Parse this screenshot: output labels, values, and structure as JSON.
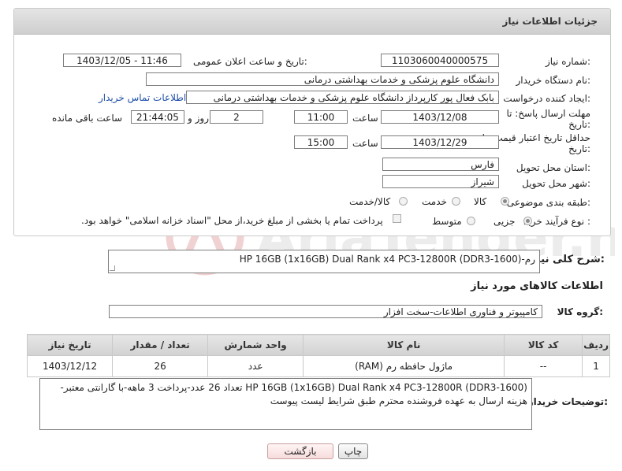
{
  "window_title": "جزئیات اطلاعات نیاز",
  "fields": {
    "need_number_label": "شماره نیاز:",
    "need_number": "1103060040000575",
    "announce_label": "تاریخ و ساعت اعلان عمومی:",
    "announce_value": "1403/12/05 - 11:46",
    "buyer_org_label": "نام دستگاه خریدار:",
    "buyer_org": "دانشگاه علوم پزشکی و خدمات بهداشتی درمانی",
    "requester_label": "ایجاد کننده درخواست:",
    "requester": "بابک فعال پور کارپرداز دانشگاه علوم پزشکی و خدمات بهداشتی درمانی",
    "contact_link": "اطلاعات تماس خریدار",
    "deadline_label_1": "مهلت ارسال پاسخ: تا",
    "deadline_label_2": "تاریخ:",
    "deadline_date": "1403/12/08",
    "time_label": "ساعت",
    "deadline_time": "11:00",
    "days_value": "2",
    "days_label": "روز و",
    "remaining_time": "21:44:05",
    "remaining_label": "ساعت باقی مانده",
    "validity_label_1": "حداقل تاریخ اعتبار قیمت: تا",
    "validity_label_2": "تاریخ:",
    "validity_date": "1403/12/29",
    "validity_time": "15:00",
    "province_label": "استان محل تحویل:",
    "province": "فارس",
    "city_label": "شهر محل تحویل:",
    "city": "شیراز",
    "category_label": "طبقه بندی موضوعی:",
    "category_options": [
      "کالا",
      "خدمت",
      "کالا/خدمت"
    ],
    "purchase_type_label": "نوع فرآیند خرید :",
    "purchase_options": [
      "جزیی",
      "متوسط"
    ],
    "payment_note": "پرداخت تمام یا بخشی از مبلغ خرید،از محل \"اسناد خزانه اسلامی\" خواهد بود."
  },
  "summary": {
    "label": "شرح کلی نیاز:",
    "value": "رم-(HP 16GB (1x16GB) Dual Rank x4 PC3-12800R (DDR3-1600"
  },
  "goods_section_title": "اطلاعات کالاهای مورد نیاز",
  "goods_group": {
    "label": "گروه کالا:",
    "value": "کامپیوتر و فناوری اطلاعات-سخت افزار"
  },
  "table": {
    "headers": [
      "ردیف",
      "کد کالا",
      "نام کالا",
      "واحد شمارش",
      "تعداد / مقدار",
      "تاریخ نیاز"
    ],
    "rows": [
      [
        "1",
        "--",
        "ماژول حافظه رم (RAM)",
        "عدد",
        "26",
        "1403/12/12"
      ]
    ]
  },
  "buyer_notes": {
    "label": "توضیحات خریدار:",
    "value": "HP 16GB (1x16GB) Dual Rank x4 PC3-12800R (DDR3-1600) تعداد 26 عدد-پرداخت 3 ماهه-با گارانتی معتبر-هزینه ارسال به عهده فروشنده محترم طبق شرایط لیست پیوست"
  },
  "buttons": {
    "print": "چاپ",
    "back": "بازگشت"
  },
  "watermark_text": "AriaTender.neT"
}
